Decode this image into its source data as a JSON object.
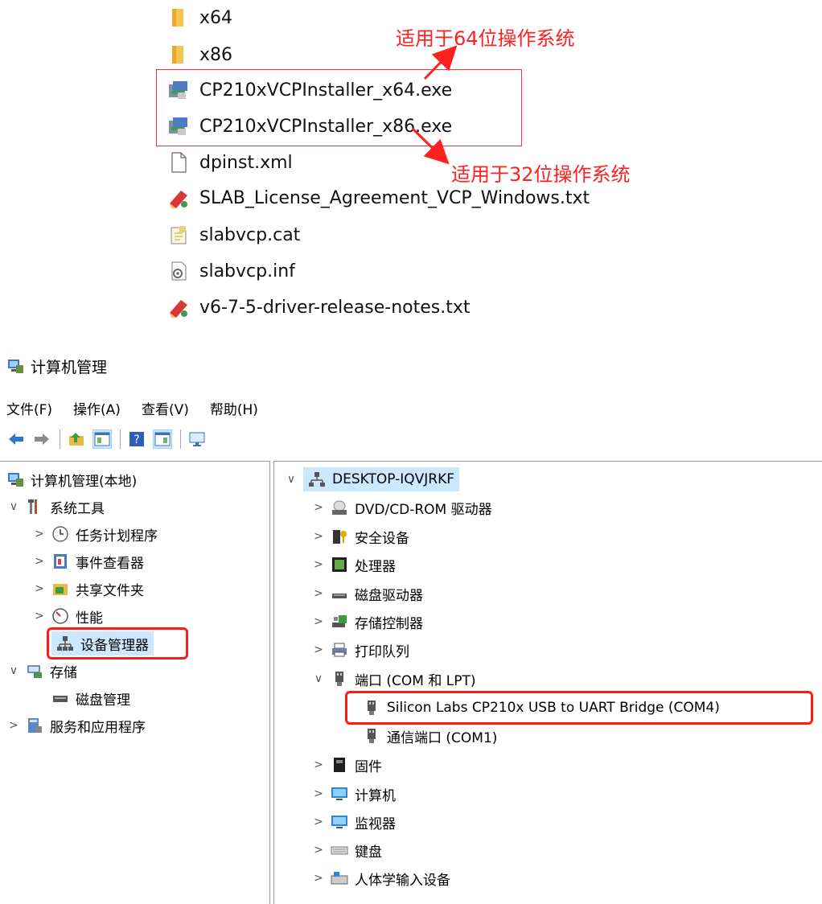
{
  "files": [
    {
      "name": "x64",
      "icon": "folder-icon"
    },
    {
      "name": "x86",
      "icon": "folder-icon"
    },
    {
      "name": "CP210xVCPInstaller_x64.exe",
      "icon": "installer-icon"
    },
    {
      "name": "CP210xVCPInstaller_x86.exe",
      "icon": "installer-icon"
    },
    {
      "name": "dpinst.xml",
      "icon": "document-icon"
    },
    {
      "name": "SLAB_License_Agreement_VCP_Windows.txt",
      "icon": "text-app-icon"
    },
    {
      "name": "slabvcp.cat",
      "icon": "catalog-icon"
    },
    {
      "name": "slabvcp.inf",
      "icon": "setup-info-icon"
    },
    {
      "name": "v6-7-5-driver-release-notes.txt",
      "icon": "text-app-icon"
    }
  ],
  "annotations": {
    "note_64": "适用于64位操作系统",
    "note_32": "适用于32位操作系统",
    "color": "#ff2020"
  },
  "window": {
    "title": "计算机管理",
    "menu": [
      "文件(F)",
      "操作(A)",
      "查看(V)",
      "帮助(H)"
    ],
    "toolbar_icons": [
      "back-arrow-icon",
      "forward-arrow-icon",
      "up-folder-icon",
      "show-tree-icon",
      "help-icon",
      "action-pane-icon",
      "monitor-icon"
    ]
  },
  "left_tree": [
    {
      "label": "计算机管理(本地)",
      "icon": "computer-management-icon",
      "expander": ""
    },
    {
      "label": "系统工具",
      "icon": "tools-icon",
      "expander": "∨"
    },
    {
      "label": "任务计划程序",
      "icon": "clock-icon",
      "expander": ">"
    },
    {
      "label": "事件查看器",
      "icon": "event-viewer-icon",
      "expander": ">"
    },
    {
      "label": "共享文件夹",
      "icon": "shared-folder-icon",
      "expander": ">"
    },
    {
      "label": "性能",
      "icon": "performance-icon",
      "expander": ">"
    },
    {
      "label": "设备管理器",
      "icon": "device-manager-icon",
      "expander": ""
    },
    {
      "label": "存储",
      "icon": "storage-icon",
      "expander": "∨"
    },
    {
      "label": "磁盘管理",
      "icon": "disk-icon",
      "expander": ""
    },
    {
      "label": "服务和应用程序",
      "icon": "services-icon",
      "expander": ">"
    }
  ],
  "right_tree": [
    {
      "label": "DESKTOP-IQVJRKF",
      "icon": "network-computer-icon",
      "expander": "∨"
    },
    {
      "label": "DVD/CD-ROM 驱动器",
      "icon": "dvd-icon",
      "expander": ">"
    },
    {
      "label": "安全设备",
      "icon": "security-device-icon",
      "expander": ">"
    },
    {
      "label": "处理器",
      "icon": "processor-icon",
      "expander": ">"
    },
    {
      "label": "磁盘驱动器",
      "icon": "disk-drive-icon",
      "expander": ">"
    },
    {
      "label": "存储控制器",
      "icon": "storage-controller-icon",
      "expander": ">"
    },
    {
      "label": "打印队列",
      "icon": "printer-icon",
      "expander": ">"
    },
    {
      "label": "端口 (COM 和 LPT)",
      "icon": "port-icon",
      "expander": "∨"
    },
    {
      "label": "Silicon Labs CP210x USB to UART Bridge (COM4)",
      "icon": "port-icon",
      "expander": ""
    },
    {
      "label": "通信端口 (COM1)",
      "icon": "port-icon",
      "expander": ""
    },
    {
      "label": "固件",
      "icon": "firmware-icon",
      "expander": ">"
    },
    {
      "label": "计算机",
      "icon": "monitor-icon",
      "expander": ">"
    },
    {
      "label": "监视器",
      "icon": "monitor-icon",
      "expander": ">"
    },
    {
      "label": "键盘",
      "icon": "keyboard-icon",
      "expander": ">"
    },
    {
      "label": "人体学输入设备",
      "icon": "hid-icon",
      "expander": ">"
    }
  ]
}
